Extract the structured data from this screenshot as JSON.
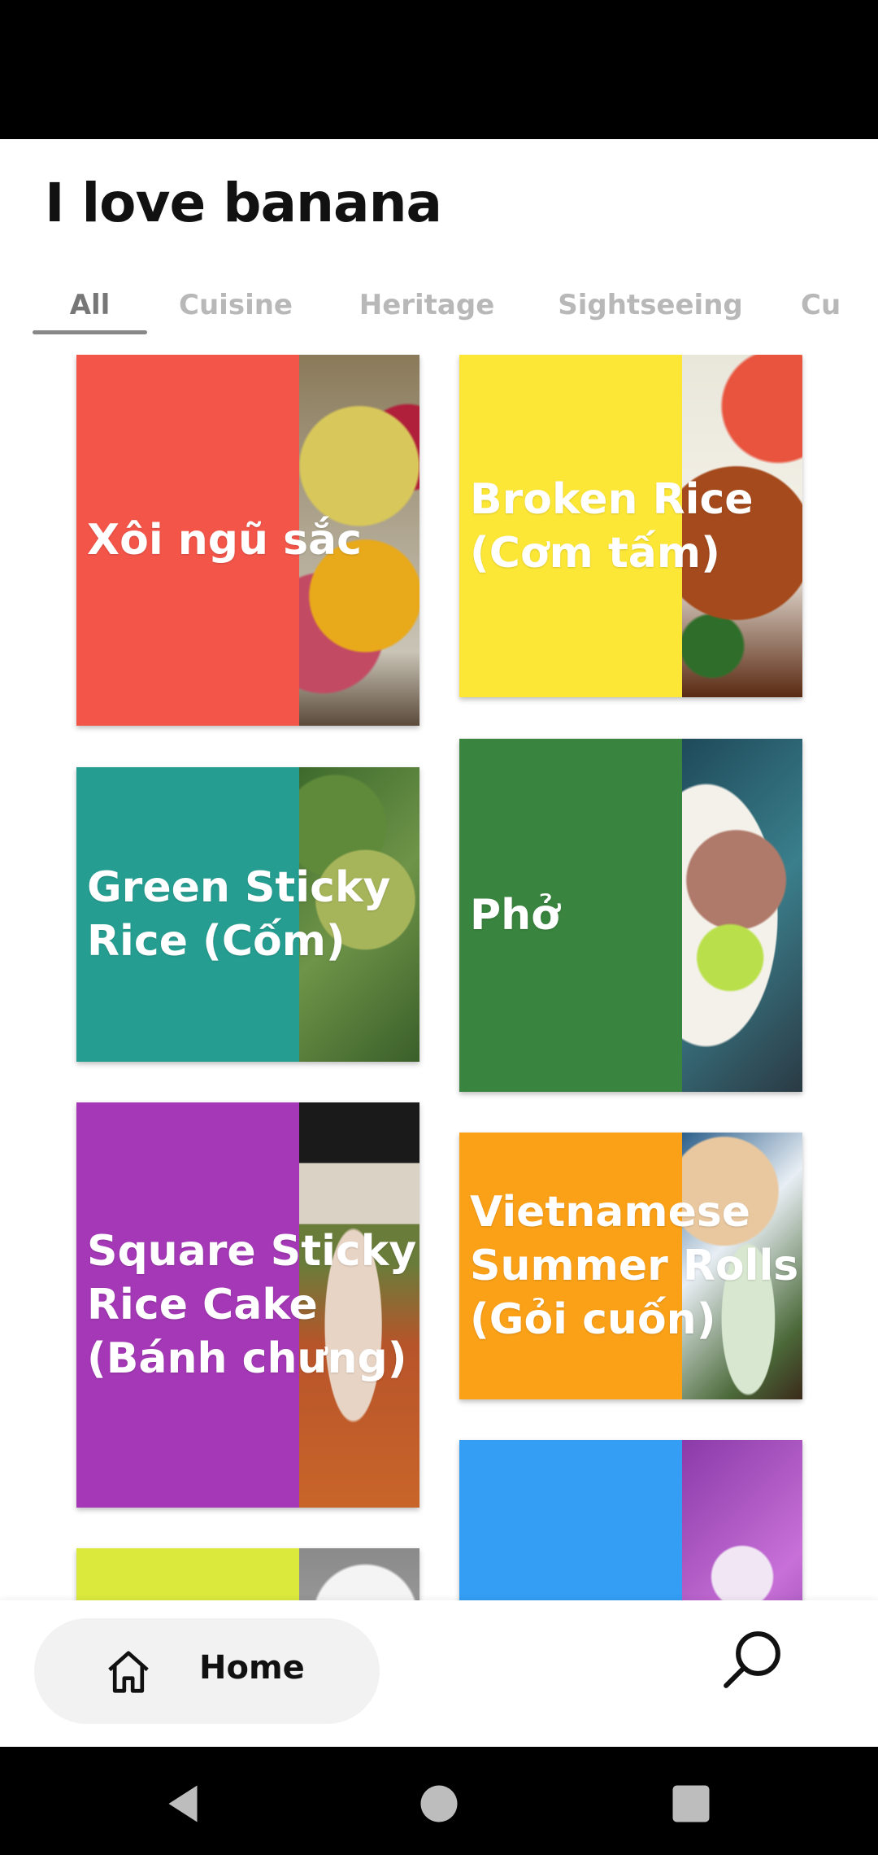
{
  "app": {
    "title": "I love banana"
  },
  "tabs": [
    {
      "label": "All",
      "active": true
    },
    {
      "label": "Cuisine",
      "active": false
    },
    {
      "label": "Heritage",
      "active": false
    },
    {
      "label": "Sightseeing",
      "active": false
    },
    {
      "label": "Cu",
      "active": false
    }
  ],
  "cards": [
    {
      "name": "Xôi ngũ sắc",
      "overlay_color": "#f2463a"
    },
    {
      "name": "Broken Rice\n(Cơm tấm)",
      "overlay_color": "#fde525"
    },
    {
      "name": "Green Sticky\nRice (Cốm)",
      "overlay_color": "#129688"
    },
    {
      "name": "Phở",
      "overlay_color": "#287a2e"
    },
    {
      "name": "Square Sticky\nRice Cake\n(Bánh chưng)",
      "overlay_color": "#9c27b0"
    },
    {
      "name": "Vietnamese\nSummer Rolls\n(Gỏi cuốn)",
      "overlay_color": "#fb9904"
    },
    {
      "name": "",
      "overlay_color": "#d8e72c"
    },
    {
      "name": "",
      "overlay_color": "#2296f3"
    }
  ],
  "bottom_nav": {
    "home_label": "Home",
    "home_icon": "home-icon",
    "search_icon": "search-icon"
  },
  "system_nav": {
    "back_icon": "back-icon",
    "home_icon": "circle-home-icon",
    "recents_icon": "recents-icon"
  }
}
